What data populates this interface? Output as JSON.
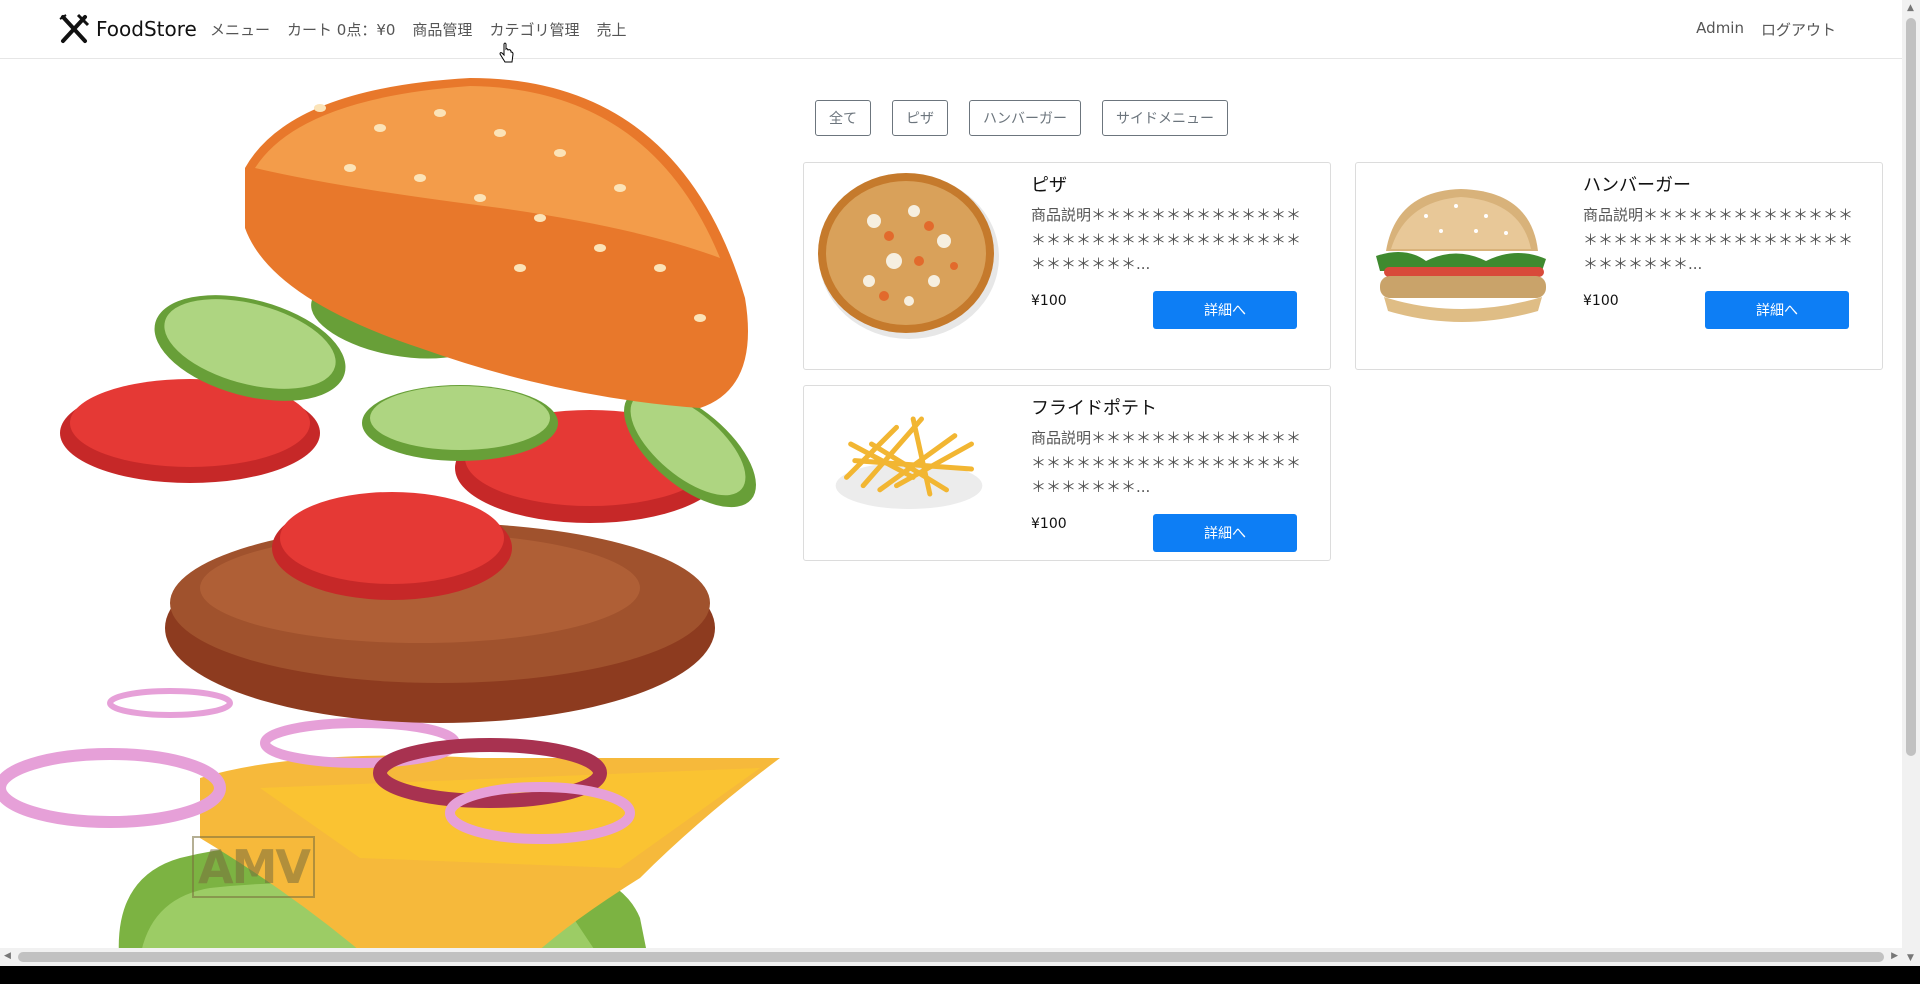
{
  "nav": {
    "brand": "FoodStore",
    "links": [
      "メニュー",
      "カート 0点：¥0",
      "商品管理",
      "カテゴリ管理",
      "売上"
    ],
    "user": "Admin",
    "logout": "ログアウト"
  },
  "hero": {
    "watermark": "AMV"
  },
  "filters": [
    "全て",
    "ピザ",
    "ハンバーガー",
    "サイドメニュー"
  ],
  "products": [
    {
      "name": "ピザ",
      "description": "商品説明＊＊＊＊＊＊＊＊＊＊＊＊＊＊＊＊＊＊＊＊＊＊＊＊＊＊＊＊＊＊＊＊＊＊＊＊＊＊＊...",
      "price": "¥100",
      "button": "詳細へ"
    },
    {
      "name": "ハンバーガー",
      "description": "商品説明＊＊＊＊＊＊＊＊＊＊＊＊＊＊＊＊＊＊＊＊＊＊＊＊＊＊＊＊＊＊＊＊＊＊＊＊＊＊＊...",
      "price": "¥100",
      "button": "詳細へ"
    },
    {
      "name": "フライドポテト",
      "description": "商品説明＊＊＊＊＊＊＊＊＊＊＊＊＊＊＊＊＊＊＊＊＊＊＊＊＊＊＊＊＊＊＊＊＊＊＊＊＊＊＊...",
      "price": "¥100",
      "button": "詳細へ"
    }
  ],
  "colors": {
    "primary": "#0d7ef5",
    "outline": "#6c757d"
  }
}
